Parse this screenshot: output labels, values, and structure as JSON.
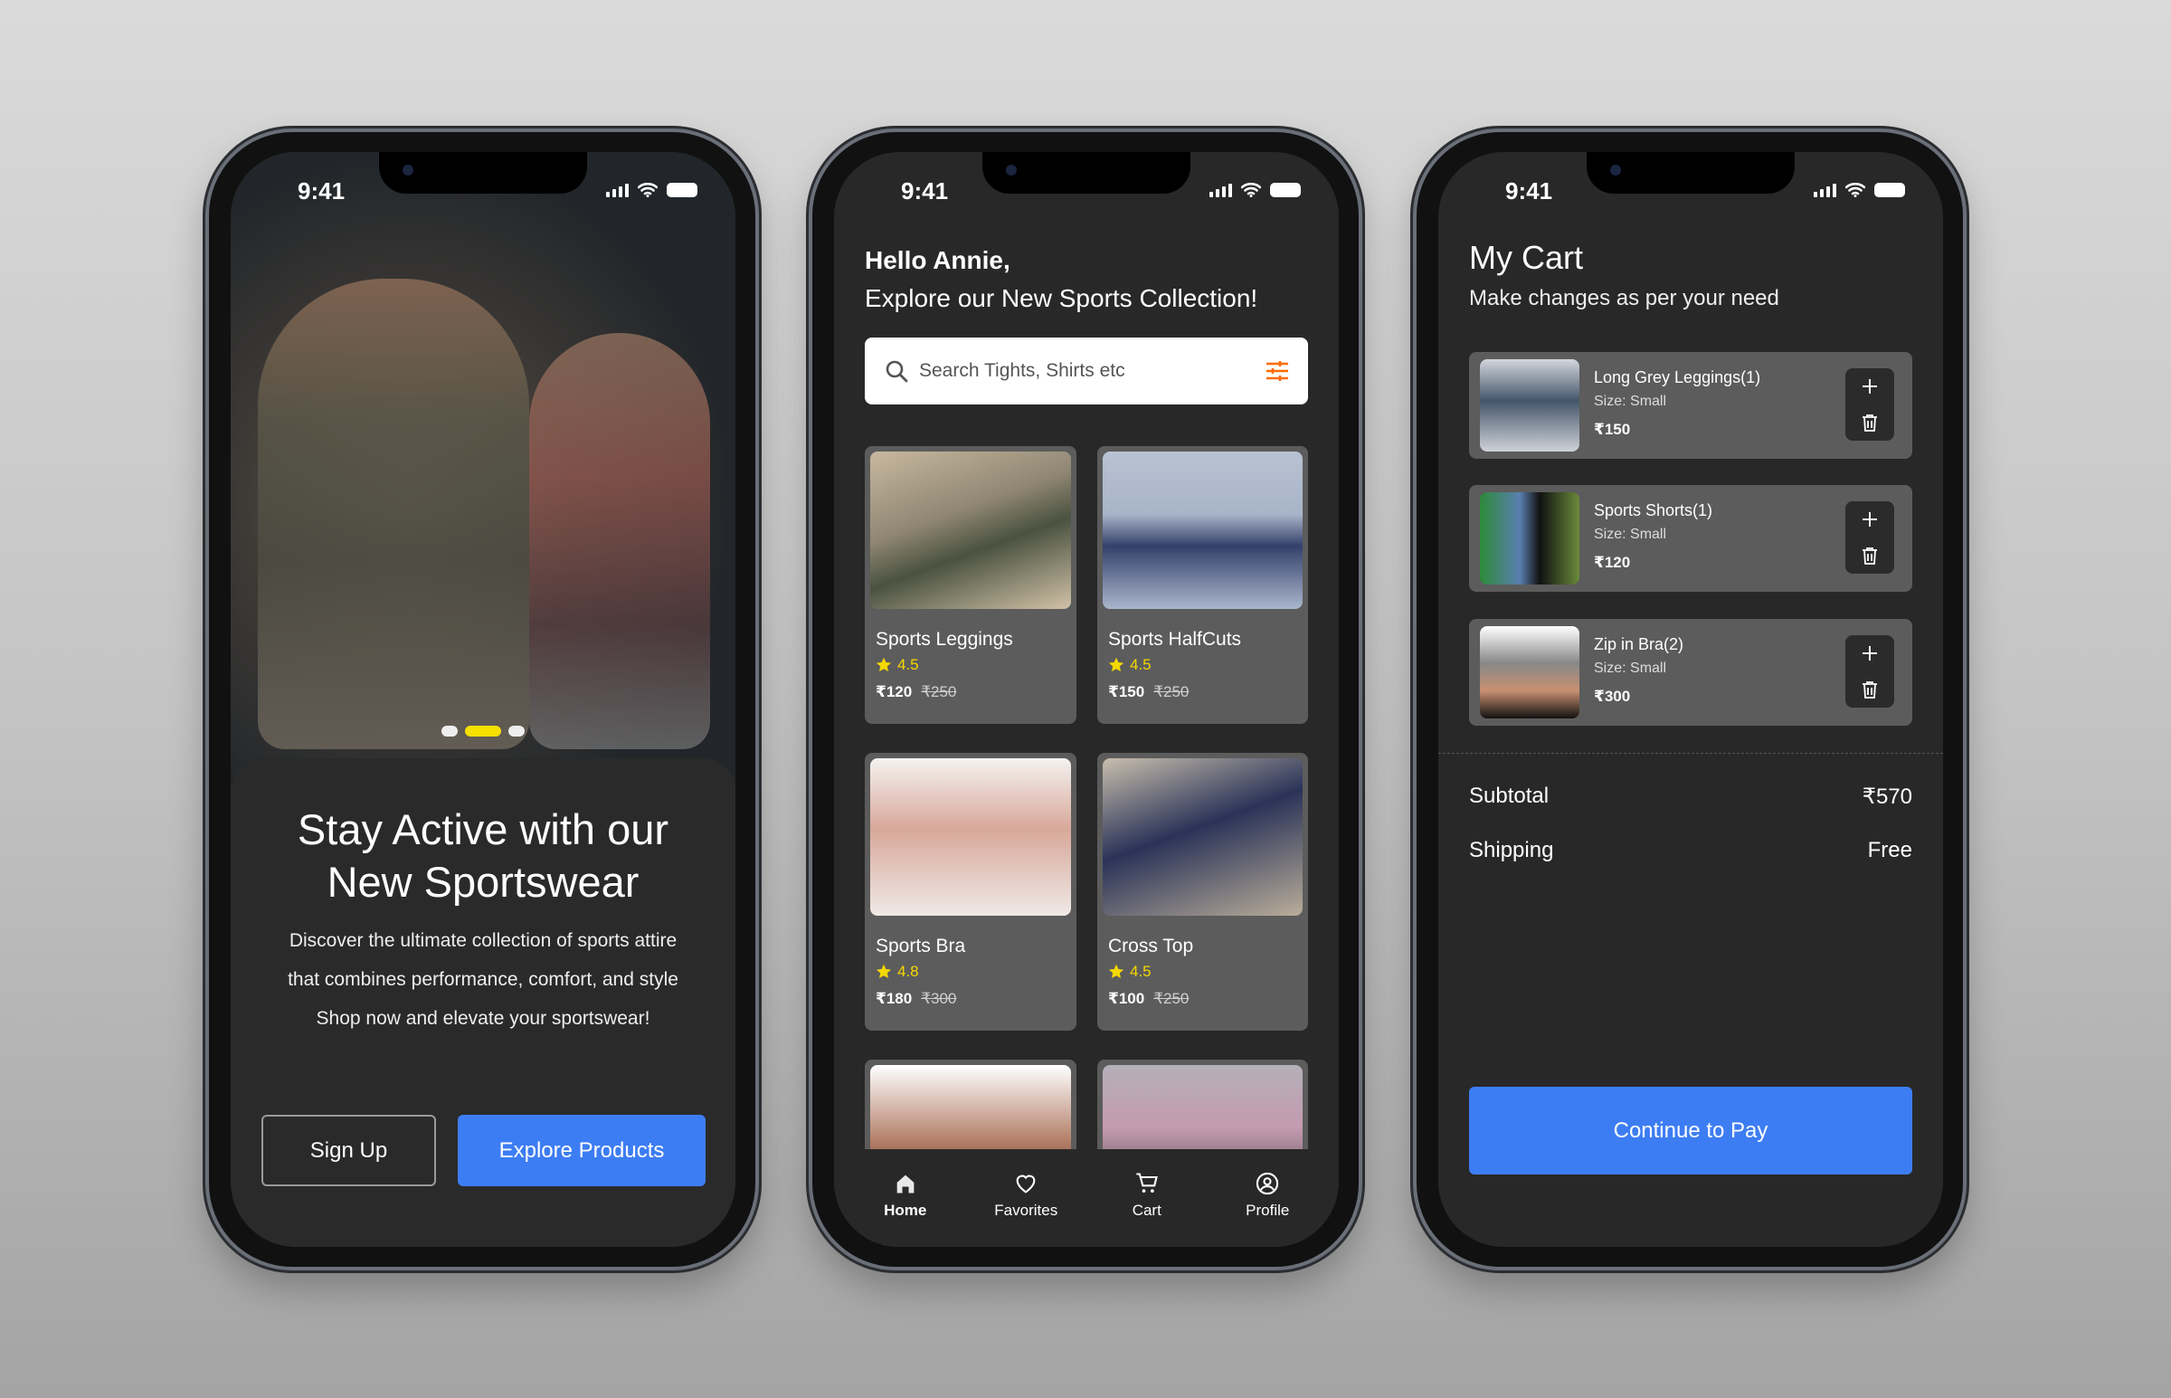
{
  "status_time": "9:41",
  "onboarding": {
    "title_line1": "Stay Active with our",
    "title_line2": "New Sportswear",
    "body": [
      "Discover the ultimate collection of sports attire",
      "that combines performance, comfort, and style",
      "Shop now and elevate your sportswear!"
    ],
    "carousel_active_index": 1,
    "carousel_count": 3,
    "signup_label": "Sign Up",
    "explore_label": "Explore Products"
  },
  "home": {
    "greeting": "Hello Annie,",
    "subtitle": "Explore our New Sports Collection!",
    "search_placeholder": "Search Tights, Shirts etc",
    "products": [
      {
        "name": "Sports Leggings",
        "rating": "4.5",
        "price": "₹120",
        "old_price": "₹250"
      },
      {
        "name": "Sports HalfCuts",
        "rating": "4.5",
        "price": "₹150",
        "old_price": "₹250"
      },
      {
        "name": "Sports Bra",
        "rating": "4.8",
        "price": "₹180",
        "old_price": "₹300"
      },
      {
        "name": "Cross Top",
        "rating": "4.5",
        "price": "₹100",
        "old_price": "₹250"
      },
      {
        "name": "",
        "rating": "",
        "price": "",
        "old_price": ""
      },
      {
        "name": "",
        "rating": "",
        "price": "",
        "old_price": ""
      }
    ],
    "nav": [
      {
        "label": "Home",
        "icon": "home-icon",
        "active": true
      },
      {
        "label": "Favorites",
        "icon": "heart-icon",
        "active": false
      },
      {
        "label": "Cart",
        "icon": "cart-icon",
        "active": false
      },
      {
        "label": "Profile",
        "icon": "profile-icon",
        "active": false
      }
    ]
  },
  "cart": {
    "title": "My Cart",
    "subtitle": "Make changes as per your need",
    "items": [
      {
        "name": "Long Grey Leggings(1)",
        "size": "Size: Small",
        "price": "₹150"
      },
      {
        "name": "Sports Shorts(1)",
        "size": "Size: Small",
        "price": "₹120"
      },
      {
        "name": "Zip in Bra(2)",
        "size": "Size: Small",
        "price": "₹300"
      }
    ],
    "subtotal_label": "Subtotal",
    "subtotal_value": "₹570",
    "shipping_label": "Shipping",
    "shipping_value": "Free",
    "pay_label": "Continue to Pay"
  },
  "colors": {
    "accent": "#3d7df3",
    "star": "#f5d800",
    "filter": "#ff6a00",
    "card": "#5c5c5c",
    "screen": "#282828"
  }
}
